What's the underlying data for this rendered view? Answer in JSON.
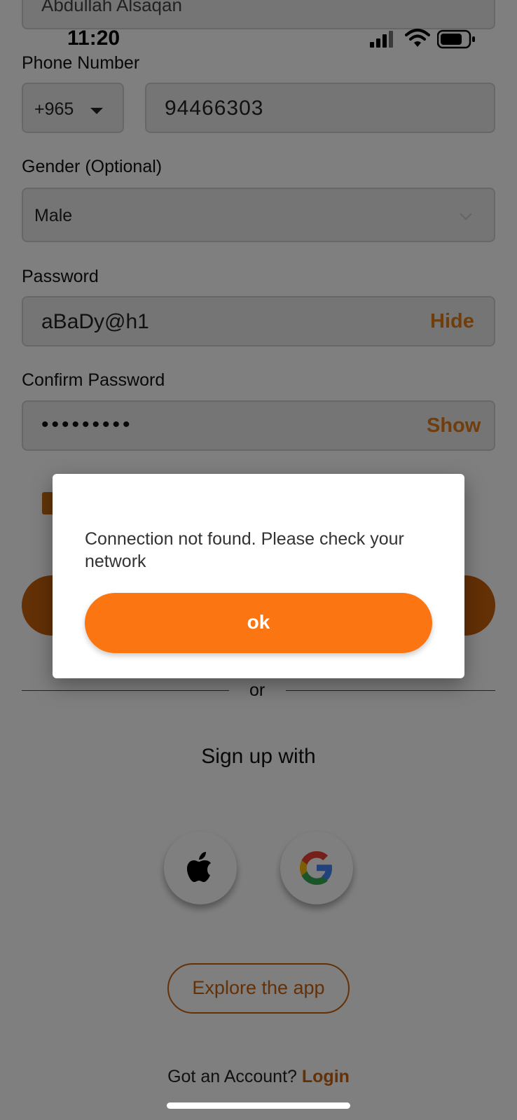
{
  "status_bar": {
    "time": "11:20"
  },
  "form": {
    "name_value": "Abdullah Alsaqan",
    "phone_label": "Phone Number",
    "country_code": "+965",
    "phone_value": "94466303",
    "gender_label": "Gender (Optional)",
    "gender_value": "Male",
    "password_label": "Password",
    "password_value": "aBaDy@h1",
    "password_toggle": "Hide",
    "confirm_label": "Confirm Password",
    "confirm_value": "•••••••••",
    "confirm_toggle": "Show"
  },
  "divider": {
    "or_text": "or"
  },
  "social": {
    "heading": "Sign up with",
    "buttons": [
      "apple-icon",
      "google-icon"
    ]
  },
  "explore": {
    "label": "Explore the app"
  },
  "footer": {
    "prompt": "Got an Account?",
    "login": "Login"
  },
  "dialog": {
    "message": "Connection not found. Please check your network",
    "ok_label": "ok"
  },
  "colors": {
    "accent": "#fb7613",
    "accent_dim": "#c8600c"
  }
}
